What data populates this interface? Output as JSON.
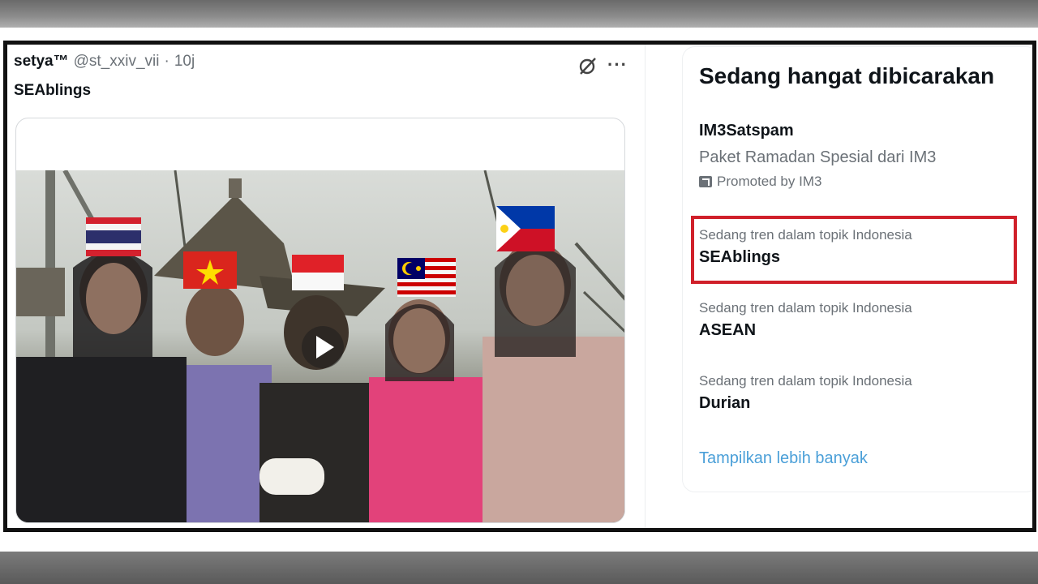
{
  "tweet": {
    "author_name": "setya™",
    "handle": "@st_xxiv_vii",
    "separator": "·",
    "time": "10j",
    "more_label": "···",
    "text": "SEAblings"
  },
  "trending": {
    "title": "Sedang hangat dibicarakan",
    "promoted": {
      "name": "IM3Satspam",
      "description": "Paket Ramadan Spesial dari IM3",
      "promoted_by": "Promoted by IM3"
    },
    "items": [
      {
        "context": "Sedang tren dalam topik Indonesia",
        "name": "SEAblings",
        "highlighted": true
      },
      {
        "context": "Sedang tren dalam topik Indonesia",
        "name": "ASEAN",
        "highlighted": false
      },
      {
        "context": "Sedang tren dalam topik Indonesia",
        "name": "Durian",
        "highlighted": false
      }
    ],
    "show_more": "Tampilkan lebih banyak"
  },
  "colors": {
    "highlight": "#d0202a",
    "link": "#4a9fd8",
    "secondary_text": "#6b7177"
  },
  "icons": [
    "grok-icon",
    "more-icon",
    "play-icon",
    "promoted-icon"
  ]
}
